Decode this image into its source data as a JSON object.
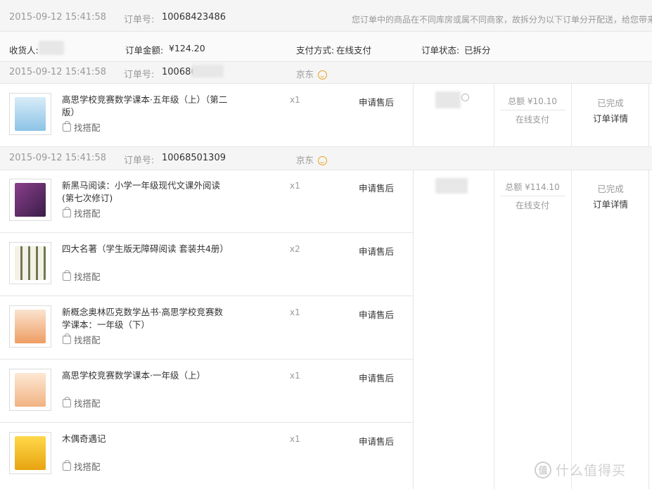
{
  "order": {
    "timestamp": "2015-09-12 15:41:58",
    "order_no_label": "订单号:",
    "order_no": "10068423486",
    "notice": "您订单中的商品在不同库房或属不同商家，故拆分为以下订单分开配送，给您带来",
    "recipient_label": "收货人:",
    "total_label": "订单金额:",
    "total_value": "¥124.20",
    "payment_label": "支付方式:",
    "payment_value": "在线支付",
    "status_label": "订单状态:",
    "status_value": "已拆分"
  },
  "suborders": [
    {
      "timestamp": "2015-09-12 15:41:58",
      "order_no_label": "订单号:",
      "order_no": "100686",
      "shop": "京东",
      "amount": "总额 ¥10.10",
      "payment": "在线支付",
      "status": "已完成",
      "detail_link": "订单详情",
      "items": [
        {
          "name": "高思学校竞赛数学课本·五年级（上）（第二版）",
          "qty": "x1",
          "after_sale": "申请售后",
          "match": "找搭配",
          "cover_color": "#b7d8ef"
        }
      ]
    },
    {
      "timestamp": "2015-09-12 15:41:58",
      "order_no_label": "订单号:",
      "order_no": "10068501309",
      "shop": "京东",
      "amount": "总额 ¥114.10",
      "payment": "在线支付",
      "status": "已完成",
      "detail_link": "订单详情",
      "items": [
        {
          "name": "新黑马阅读：小学一年级现代文课外阅读(第七次修订)",
          "qty": "x1",
          "after_sale": "申请售后",
          "match": "找搭配",
          "cover_color": "#6b2f6e"
        },
        {
          "name": "四大名著（学生版无障碍阅读 套装共4册）",
          "qty": "x2",
          "after_sale": "申请售后",
          "match": "找搭配",
          "cover_color": "#d9d3c4"
        },
        {
          "name": "新概念奥林匹克数学丛书·高思学校竞赛数学课本：一年级（下）",
          "qty": "x1",
          "after_sale": "申请售后",
          "match": "找搭配",
          "cover_color": "#f0b48a"
        },
        {
          "name": "高思学校竞赛数学课本·一年级（上）",
          "qty": "x1",
          "after_sale": "申请售后",
          "match": "找搭配",
          "cover_color": "#f3c7a0"
        },
        {
          "name": "木偶奇遇记",
          "qty": "x1",
          "after_sale": "申请售后",
          "match": "找搭配",
          "cover_color": "#f4c91c"
        }
      ]
    }
  ],
  "watermark": {
    "icon_char": "值",
    "text": "什么值得买"
  }
}
